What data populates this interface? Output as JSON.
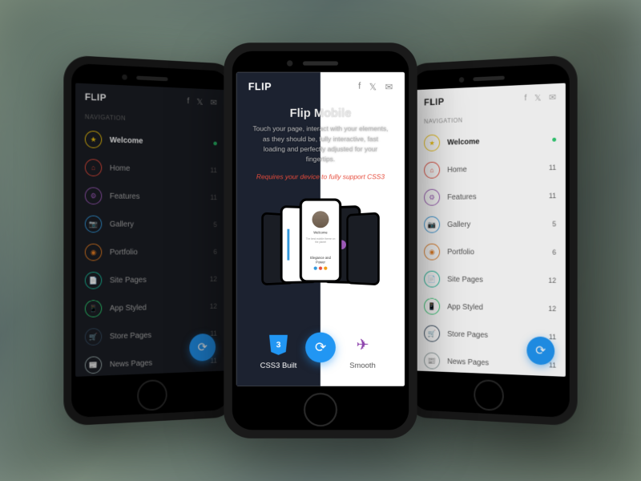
{
  "brand": "FLIP",
  "nav": {
    "heading": "NAVIGATION",
    "items": [
      {
        "label": "Welcome",
        "icon": "star-icon",
        "color": "#f1c40f",
        "badge": "",
        "dot": "#2ecc71",
        "active": true
      },
      {
        "label": "Home",
        "icon": "home-icon",
        "color": "#e74c3c",
        "badge": "11"
      },
      {
        "label": "Features",
        "icon": "gear-icon",
        "color": "#9b59b6",
        "badge": "11"
      },
      {
        "label": "Gallery",
        "icon": "camera-icon",
        "color": "#3498db",
        "badge": "5"
      },
      {
        "label": "Portfolio",
        "icon": "image-icon",
        "color": "#e67e22",
        "badge": "6"
      },
      {
        "label": "Site Pages",
        "icon": "file-icon",
        "color": "#1abc9c",
        "badge": "12"
      },
      {
        "label": "App Styled",
        "icon": "phone-icon",
        "color": "#2ecc71",
        "badge": "12"
      },
      {
        "label": "Store Pages",
        "icon": "cart-icon",
        "color": "#34495e",
        "badge": "11"
      },
      {
        "label": "News Pages",
        "icon": "news-icon",
        "color": "#95a5a6",
        "badge": "11"
      }
    ]
  },
  "center": {
    "title": "Flip Mobile",
    "desc": "Touch your page, interact with your elements, as they should be, fully interactive, fast loading and perfectly adjusted for your fingertips.",
    "requirement": "Requires your device to fully support CSS3",
    "hero_card": {
      "title": "Welcome",
      "subtitle": "Elegance and Power"
    },
    "features": [
      {
        "label": "CSS3 Built",
        "icon": "css3-icon"
      },
      {
        "label": "Smooth",
        "icon": "rocket-icon"
      }
    ]
  },
  "social": [
    "facebook",
    "twitter",
    "mail"
  ]
}
